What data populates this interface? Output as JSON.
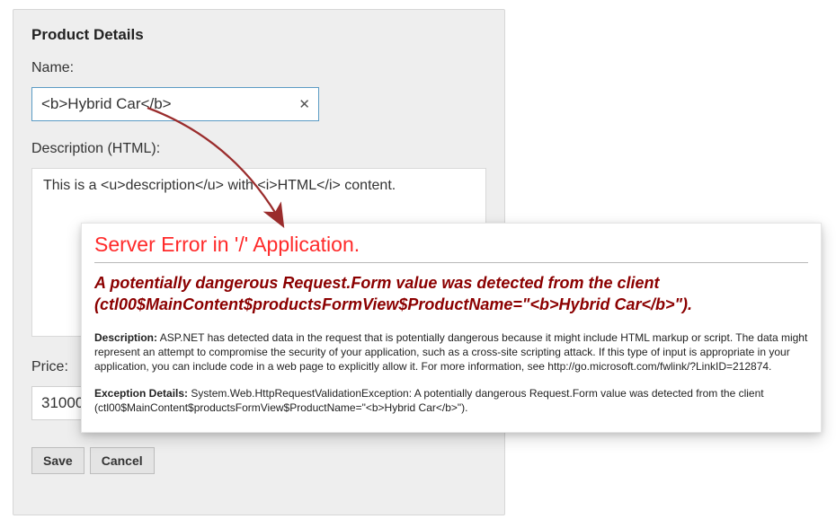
{
  "panel": {
    "title": "Product Details",
    "name_label": "Name:",
    "name_value": "<b>Hybrid Car</b>",
    "desc_label": "Description (HTML):",
    "desc_value": "This is a <u>description</u> with <i>HTML</i> content.",
    "price_label": "Price:",
    "price_value": "31000.0",
    "save_label": "Save",
    "cancel_label": "Cancel"
  },
  "error": {
    "title": "Server Error in '/' Application.",
    "subhead": "A potentially dangerous Request.Form value was detected from the client (ctl00$MainContent$productsFormView$ProductName=\"<b>Hybrid Car</b>\").",
    "desc_label": "Description:",
    "desc_text": " ASP.NET has detected data in the request that is potentially dangerous because it might include HTML markup or script. The data might represent an attempt to compromise the security of your application, such as a cross-site scripting attack. If this type of input is appropriate in your application, you can include code in a web page to explicitly allow it. For more information, see http://go.microsoft.com/fwlink/?LinkID=212874.",
    "exc_label": "Exception Details:",
    "exc_text": " System.Web.HttpRequestValidationException: A potentially dangerous Request.Form value was detected from the client (ctl00$MainContent$productsFormView$ProductName=\"<b>Hybrid Car</b>\")."
  }
}
